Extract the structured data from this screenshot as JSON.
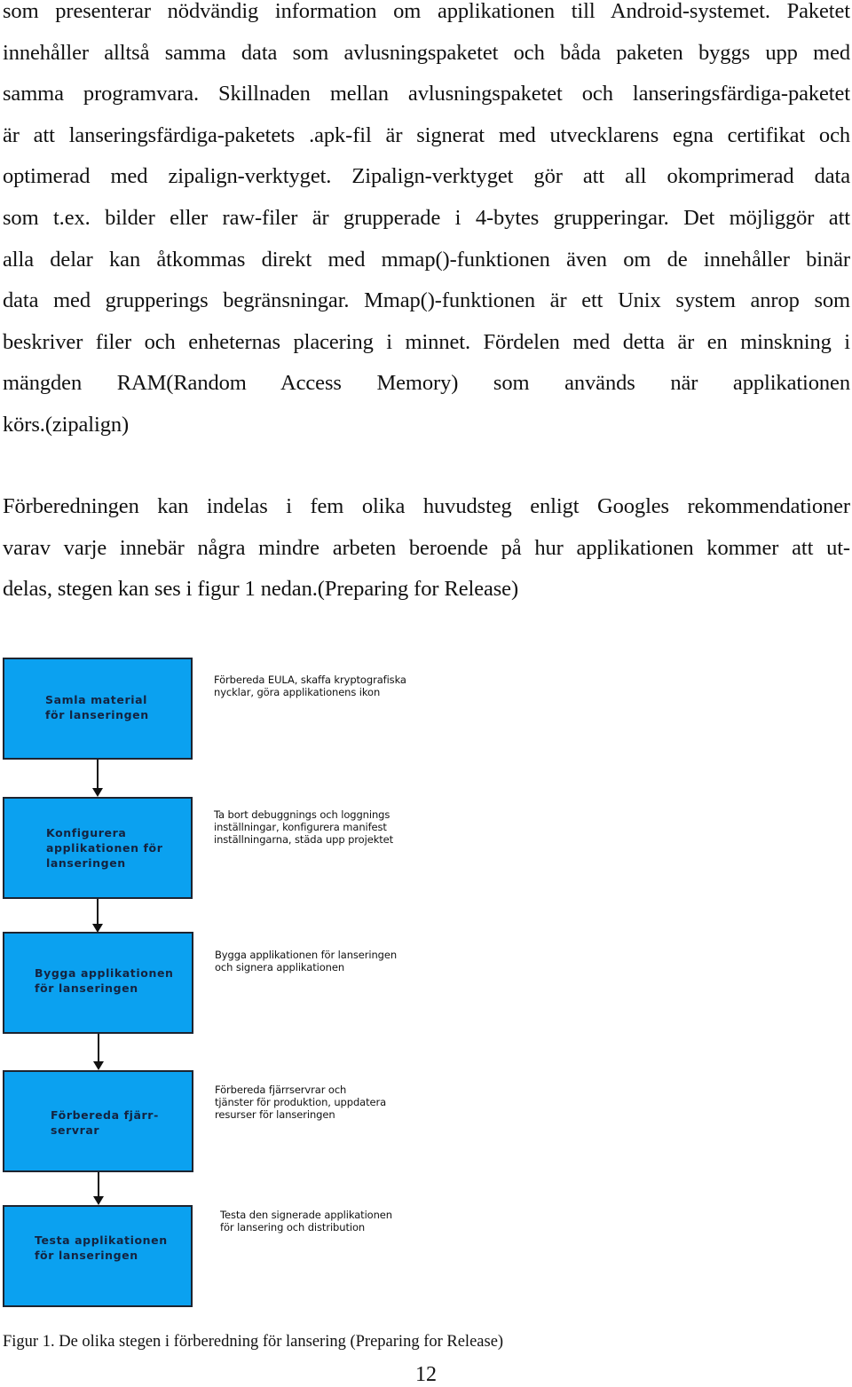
{
  "paragraph1_lines": [
    "som presenterar nödvändig information om applikationen till Android-systemet. Paketet",
    "innehåller alltså samma data som avlusningspaketet och båda paketen byggs upp med",
    "samma programvara. Skillnaden mellan avlusningspaketet och lanseringsfärdiga-paketet",
    "är att lanseringsfärdiga-paketets .apk-fil är signerat med utvecklarens egna certifikat och",
    "optimerad med zipalign-verktyget. Zipalign-verktyget gör att all okomprimerad data",
    "som t.ex. bilder eller raw-filer är grupperade i 4-bytes grupperingar. Det möjliggör att",
    "alla delar kan åtkommas direkt med mmap()-funktionen även om de innehåller binär",
    "data med grupperings begränsningar. Mmap()-funktionen är ett Unix system anrop som",
    "beskriver filer och enheternas placering i minnet. Fördelen med detta är en minskning i",
    "mängden RAM(Random Access Memory) som används när applikationen",
    "körs.(zipalign)"
  ],
  "paragraph2_lines": [
    "Förberedningen kan indelas i fem olika huvudsteg enligt Googles rekommendationer",
    "varav varje innebär några mindre arbeten beroende på hur applikationen kommer att ut-",
    "delas, stegen kan ses i figur 1 nedan.(Preparing for Release)"
  ],
  "figure": {
    "box_color": "#0ba1f0",
    "steps": [
      {
        "label_lines": [
          "Samla material",
          "för lanseringen"
        ],
        "description_lines": [
          "Förbereda EULA, skaffa kryptografiska",
          "nycklar, göra applikationens ikon"
        ]
      },
      {
        "label_lines": [
          "Konfigurera",
          "applikationen för",
          "lanseringen"
        ],
        "description_lines": [
          "Ta bort debuggnings och loggnings",
          "inställningar, konfigurera manifest",
          "inställningarna, städa upp projektet"
        ]
      },
      {
        "label_lines": [
          "Bygga applikationen",
          "för lanseringen"
        ],
        "description_lines": [
          "Bygga applikationen för lanseringen",
          "och signera applikationen"
        ]
      },
      {
        "label_lines": [
          "Förbereda fjärr-",
          "servrar"
        ],
        "description_lines": [
          "Förbereda fjärrservrar och",
          "tjänster för produktion, uppdatera",
          "resurser för lanseringen"
        ]
      },
      {
        "label_lines": [
          "Testa applikationen",
          "för lanseringen"
        ],
        "description_lines": [
          "Testa den signerade applikationen",
          "för lansering och distribution"
        ]
      }
    ],
    "caption": "Figur 1. De olika stegen i förberedning för lansering (Preparing for Release)"
  },
  "page_number": "12"
}
